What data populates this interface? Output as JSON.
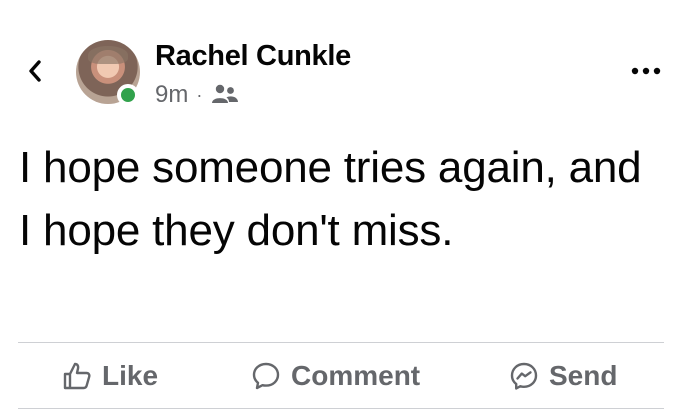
{
  "post": {
    "author": "Rachel Cunkle",
    "time": "9m",
    "separator": "·",
    "audience_icon": "friends-icon",
    "text": "I hope someone tries again, and I hope they don't miss.",
    "author_online": true
  },
  "header": {
    "back_icon": "chevron-left-icon",
    "more_icon": "more-options-icon"
  },
  "actions": {
    "like": {
      "label": "Like",
      "icon": "thumbs-up-icon"
    },
    "comment": {
      "label": "Comment",
      "icon": "comment-bubble-icon"
    },
    "send": {
      "label": "Send",
      "icon": "messenger-icon"
    }
  },
  "colors": {
    "text_primary": "#050505",
    "text_secondary": "#65676b",
    "online_green": "#31a24c",
    "divider": "#ced0d4"
  }
}
